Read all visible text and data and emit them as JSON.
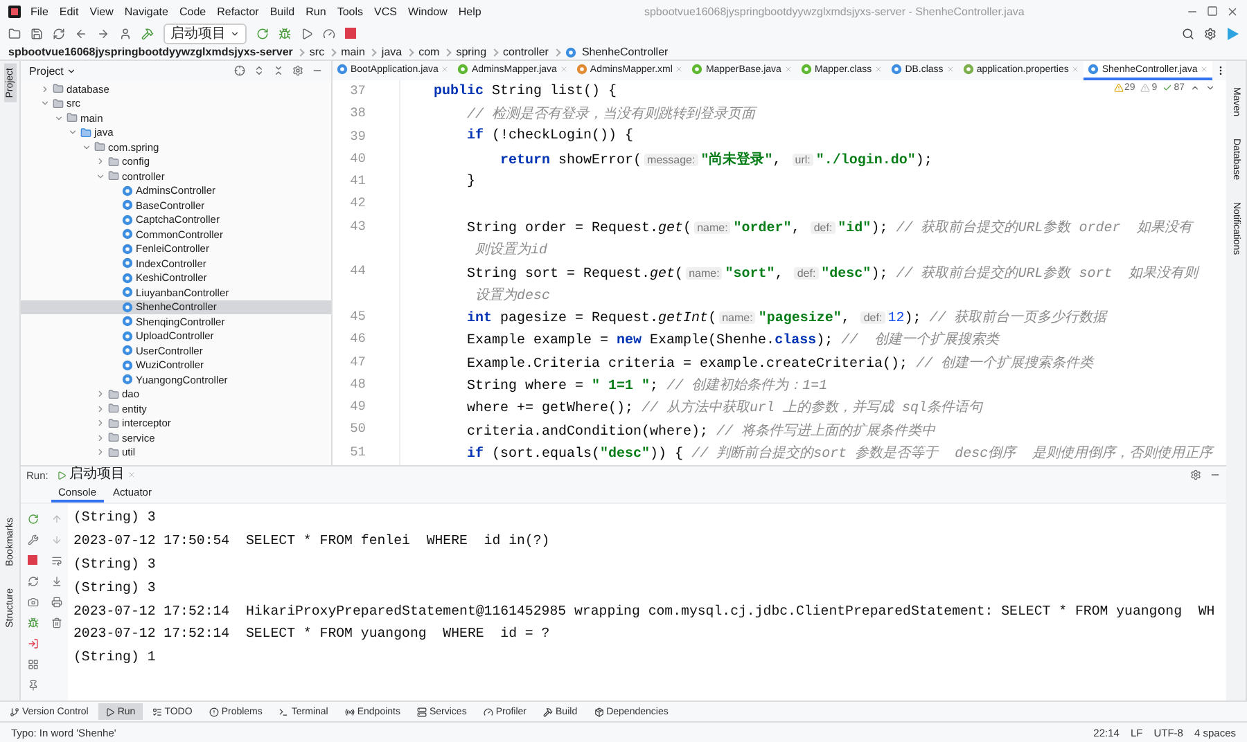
{
  "window": {
    "title": "spbootvue16068jyspringbootdyywzglxmdsjyxs-server - ShenheController.java"
  },
  "menu": [
    "File",
    "Edit",
    "View",
    "Navigate",
    "Code",
    "Refactor",
    "Build",
    "Run",
    "Tools",
    "VCS",
    "Window",
    "Help"
  ],
  "run_config": "启动项目",
  "breadcrumb": [
    "spbootvue16068jyspringbootdyywzglxmdsjyxs-server",
    "src",
    "main",
    "java",
    "com",
    "spring",
    "controller",
    "ShenheController"
  ],
  "project": {
    "title": "Project",
    "tree": [
      {
        "label": "database",
        "kind": "folder",
        "expanded": false,
        "selected": false
      },
      {
        "label": "src",
        "kind": "folder",
        "expanded": true,
        "selected": false,
        "children": [
          {
            "label": "main",
            "kind": "folder",
            "expanded": true,
            "selected": false,
            "children": [
              {
                "label": "java",
                "kind": "source",
                "expanded": true,
                "selected": false,
                "children": [
                  {
                    "label": "com.spring",
                    "kind": "folder",
                    "expanded": true,
                    "selected": false,
                    "children": [
                      {
                        "label": "config",
                        "kind": "folder",
                        "expanded": false,
                        "selected": false
                      },
                      {
                        "label": "controller",
                        "kind": "folder",
                        "expanded": true,
                        "selected": false,
                        "children": [
                          {
                            "label": "AdminsController",
                            "kind": "class",
                            "selected": false
                          },
                          {
                            "label": "BaseController",
                            "kind": "class",
                            "selected": false
                          },
                          {
                            "label": "CaptchaController",
                            "kind": "class",
                            "selected": false
                          },
                          {
                            "label": "CommonController",
                            "kind": "class",
                            "selected": false
                          },
                          {
                            "label": "FenleiController",
                            "kind": "class",
                            "selected": false
                          },
                          {
                            "label": "IndexController",
                            "kind": "class",
                            "selected": false
                          },
                          {
                            "label": "KeshiController",
                            "kind": "class",
                            "selected": false
                          },
                          {
                            "label": "LiuyanbanController",
                            "kind": "class",
                            "selected": false
                          },
                          {
                            "label": "ShenheController",
                            "kind": "class",
                            "selected": true
                          },
                          {
                            "label": "ShenqingController",
                            "kind": "class",
                            "selected": false
                          },
                          {
                            "label": "UploadController",
                            "kind": "class",
                            "selected": false
                          },
                          {
                            "label": "UserController",
                            "kind": "class",
                            "selected": false
                          },
                          {
                            "label": "WuziController",
                            "kind": "class",
                            "selected": false
                          },
                          {
                            "label": "YuangongController",
                            "kind": "class",
                            "selected": false
                          }
                        ]
                      },
                      {
                        "label": "dao",
                        "kind": "folder",
                        "expanded": false,
                        "selected": false
                      },
                      {
                        "label": "entity",
                        "kind": "folder",
                        "expanded": false,
                        "selected": false
                      },
                      {
                        "label": "interceptor",
                        "kind": "folder",
                        "expanded": false,
                        "selected": false
                      },
                      {
                        "label": "service",
                        "kind": "folder",
                        "expanded": false,
                        "selected": false
                      },
                      {
                        "label": "util",
                        "kind": "folder",
                        "expanded": false,
                        "selected": false
                      }
                    ]
                  }
                ]
              }
            ]
          }
        ]
      }
    ]
  },
  "editor_tabs": [
    {
      "label": "BootApplication.java",
      "kind": "class",
      "selected": false
    },
    {
      "label": "AdminsMapper.java",
      "kind": "interface",
      "selected": false
    },
    {
      "label": "AdminsMapper.xml",
      "kind": "xml",
      "selected": false
    },
    {
      "label": "MapperBase.java",
      "kind": "interface",
      "selected": false
    },
    {
      "label": "Mapper.class",
      "kind": "interface",
      "selected": false
    },
    {
      "label": "DB.class",
      "kind": "class",
      "selected": false
    },
    {
      "label": "application.properties",
      "kind": "properties",
      "selected": false
    },
    {
      "label": "ShenheController.java",
      "kind": "class",
      "selected": true
    }
  ],
  "inspections": {
    "warnings": "29",
    "weak": "9",
    "ok": "87"
  },
  "code": [
    {
      "n": "37",
      "t": [
        {
          "kind": "keyword",
          "text": "    public"
        },
        {
          "kind": "plain",
          "text": " String list() {"
        }
      ]
    },
    {
      "n": "38",
      "t": [
        {
          "kind": "comment",
          "text": "        // 检测是否有登录，当没有则跳转到登录页面"
        }
      ]
    },
    {
      "n": "39",
      "t": [
        {
          "kind": "keyword",
          "text": "        if"
        },
        {
          "kind": "plain",
          "text": " (!checkLogin()) {"
        }
      ]
    },
    {
      "n": "40",
      "t": [
        {
          "kind": "keyword",
          "text": "            return"
        },
        {
          "kind": "plain",
          "text": " showError("
        },
        {
          "kind": "hint",
          "text": "message:"
        },
        {
          "kind": "string",
          "text": "\"尚未登录\""
        },
        {
          "kind": "plain",
          "text": ", "
        },
        {
          "kind": "hint",
          "text": "url:"
        },
        {
          "kind": "string",
          "text": "\"./login.do\""
        },
        {
          "kind": "plain",
          "text": ");"
        }
      ]
    },
    {
      "n": "41",
      "t": [
        {
          "kind": "plain",
          "text": "        }"
        }
      ]
    },
    {
      "n": "42"
    },
    {
      "n": "43",
      "t": [
        {
          "kind": "plain",
          "text": "        String order = Request."
        },
        {
          "kind": "method",
          "text": "get"
        },
        {
          "kind": "plain",
          "text": "("
        },
        {
          "kind": "hint",
          "text": "name:"
        },
        {
          "kind": "string",
          "text": "\"order\""
        },
        {
          "kind": "plain",
          "text": ", "
        },
        {
          "kind": "hint",
          "text": "def:"
        },
        {
          "kind": "string",
          "text": "\"id\""
        },
        {
          "kind": "plain",
          "text": "); "
        },
        {
          "kind": "comment",
          "text": "// 获取前台提交的URL参数 order  如果没有"
        }
      ]
    },
    {
      "t": [
        {
          "kind": "comment",
          "text": "         则设置为id"
        }
      ]
    },
    {
      "n": "44",
      "t": [
        {
          "kind": "plain",
          "text": "        String sort = Request."
        },
        {
          "kind": "method",
          "text": "get"
        },
        {
          "kind": "plain",
          "text": "("
        },
        {
          "kind": "hint",
          "text": "name:"
        },
        {
          "kind": "string",
          "text": "\"sort\""
        },
        {
          "kind": "plain",
          "text": ", "
        },
        {
          "kind": "hint",
          "text": "def:"
        },
        {
          "kind": "string",
          "text": "\"desc\""
        },
        {
          "kind": "plain",
          "text": "); "
        },
        {
          "kind": "comment",
          "text": "// 获取前台提交的URL参数 sort  如果没有则"
        }
      ]
    },
    {
      "t": [
        {
          "kind": "comment",
          "text": "         设置为desc"
        }
      ]
    },
    {
      "n": "45",
      "t": [
        {
          "kind": "keyword",
          "text": "        int"
        },
        {
          "kind": "plain",
          "text": " pagesize = Request."
        },
        {
          "kind": "method",
          "text": "getInt"
        },
        {
          "kind": "plain",
          "text": "("
        },
        {
          "kind": "hint",
          "text": "name:"
        },
        {
          "kind": "string",
          "text": "\"pagesize\""
        },
        {
          "kind": "plain",
          "text": ", "
        },
        {
          "kind": "hint",
          "text": "def:"
        },
        {
          "kind": "number",
          "text": "12"
        },
        {
          "kind": "plain",
          "text": "); "
        },
        {
          "kind": "comment",
          "text": "// 获取前台一页多少行数据"
        }
      ]
    },
    {
      "n": "46",
      "t": [
        {
          "kind": "plain",
          "text": "        Example example = "
        },
        {
          "kind": "keyword",
          "text": "new"
        },
        {
          "kind": "plain",
          "text": " Example(Shenhe."
        },
        {
          "kind": "keyword",
          "text": "class"
        },
        {
          "kind": "plain",
          "text": "); "
        },
        {
          "kind": "comment",
          "text": "//  创建一个扩展搜索类"
        }
      ]
    },
    {
      "n": "47",
      "t": [
        {
          "kind": "plain",
          "text": "        Example.Criteria criteria = example.createCriteria(); "
        },
        {
          "kind": "comment",
          "text": "// 创建一个扩展搜索条件类"
        }
      ]
    },
    {
      "n": "48",
      "t": [
        {
          "kind": "plain",
          "text": "        String where = "
        },
        {
          "kind": "string",
          "text": "\" 1=1 \""
        },
        {
          "kind": "plain",
          "text": "; "
        },
        {
          "kind": "comment",
          "text": "// 创建初始条件为：1=1"
        }
      ]
    },
    {
      "n": "49",
      "t": [
        {
          "kind": "plain",
          "text": "        where += getWhere(); "
        },
        {
          "kind": "comment",
          "text": "// 从方法中获取url 上的参数，并写成 sql条件语句"
        }
      ]
    },
    {
      "n": "50",
      "t": [
        {
          "kind": "plain",
          "text": "        criteria.andCondition(where); "
        },
        {
          "kind": "comment",
          "text": "// 将条件写进上面的扩展条件类中"
        }
      ]
    },
    {
      "n": "51",
      "t": [
        {
          "kind": "keyword",
          "text": "        if"
        },
        {
          "kind": "plain",
          "text": " (sort.equals("
        },
        {
          "kind": "string",
          "text": "\"desc\""
        },
        {
          "kind": "plain",
          "text": ")) { "
        },
        {
          "kind": "comment",
          "text": "// 判断前台提交的sort 参数是否等于  desc倒序  是则使用倒序，否则使用正序"
        }
      ]
    }
  ],
  "right_tools": [
    "Maven",
    "Database",
    "Notifications"
  ],
  "left_tools": [
    "Project",
    "Bookmarks",
    "Structure"
  ],
  "run": {
    "label": "Run:",
    "tab": "启动项目",
    "tabs": [
      {
        "label": "Console",
        "selected": true
      },
      {
        "label": "Actuator",
        "selected": false
      }
    ],
    "console": [
      "(String) 3",
      "2023-07-12 17:50:54  SELECT * FROM fenlei  WHERE  id in(?)",
      "(String) 3",
      "(String) 3",
      "2023-07-12 17:52:14  HikariProxyPreparedStatement@1161452985 wrapping com.mysql.cj.jdbc.ClientPreparedStatement: SELECT * FROM yuangong  WH",
      "2023-07-12 17:52:14  SELECT * FROM yuangong  WHERE  id = ?",
      "(String) 1"
    ]
  },
  "tool_tabs": [
    {
      "label": "Version Control",
      "selected": false
    },
    {
      "label": "Run",
      "selected": true
    },
    {
      "label": "TODO",
      "selected": false
    },
    {
      "label": "Problems",
      "selected": false
    },
    {
      "label": "Terminal",
      "selected": false
    },
    {
      "label": "Endpoints",
      "selected": false
    },
    {
      "label": "Services",
      "selected": false
    },
    {
      "label": "Profiler",
      "selected": false
    },
    {
      "label": "Build",
      "selected": false
    },
    {
      "label": "Dependencies",
      "selected": false
    }
  ],
  "status": {
    "message": "Typo: In word 'Shenhe'",
    "items": [
      "22:14",
      "LF",
      "UTF-8",
      "4 spaces"
    ]
  }
}
